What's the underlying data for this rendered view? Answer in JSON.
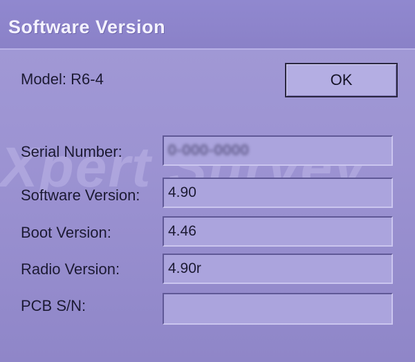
{
  "window": {
    "title": "Software Version"
  },
  "watermark": "Xpert Survey",
  "model": {
    "label": "Model: R6-4"
  },
  "buttons": {
    "ok_label": "OK"
  },
  "fields": [
    {
      "label": "Serial Number:",
      "value": "0-000-0000",
      "redacted": true
    },
    {
      "label": "Software Version:",
      "value": "4.90"
    },
    {
      "label": "Boot Version:",
      "value": "4.46"
    },
    {
      "label": "Radio Version:",
      "value": "4.90r"
    },
    {
      "label": "PCB S/N:",
      "value": ""
    }
  ]
}
